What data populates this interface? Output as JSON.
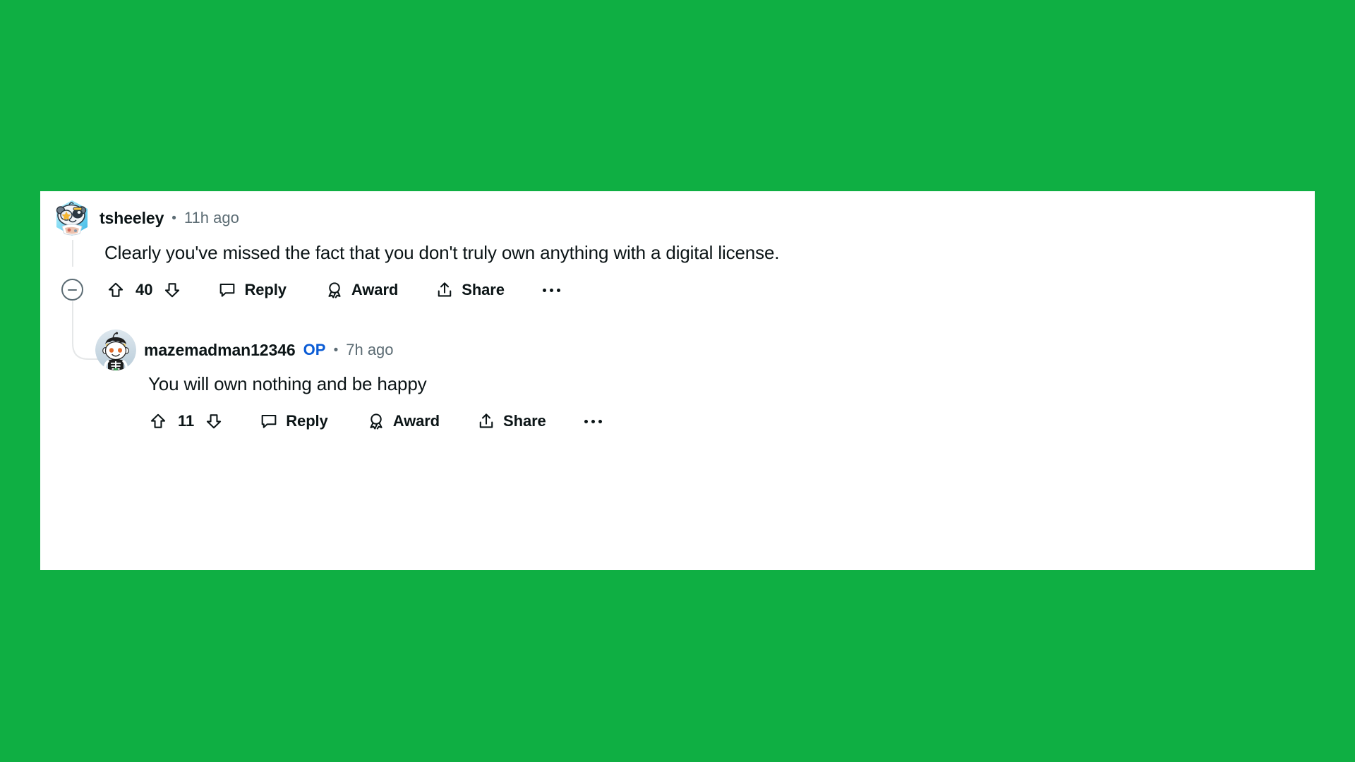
{
  "page": {
    "background_color": "#0FAF43",
    "card_background": "#FFFFFF",
    "platform": "reddit-comment-thread"
  },
  "comments": [
    {
      "id": "root",
      "author": "tsheeley",
      "is_op": false,
      "op_label": "",
      "separator": "•",
      "timestamp": "11h ago",
      "body": "Clearly you've missed the fact that you don't truly own anything with a digital license.",
      "avatar": {
        "name": "panda-gamer-avatar",
        "shape": "rounded-hex",
        "background_color": "#8FD8F0"
      },
      "actions": {
        "collapse_icon": "minus-circle-icon",
        "upvote_icon": "upvote-arrow-icon",
        "vote_count": "40",
        "downvote_icon": "downvote-arrow-icon",
        "reply_icon": "comment-bubble-icon",
        "reply_label": "Reply",
        "award_icon": "award-ribbon-icon",
        "award_label": "Award",
        "share_icon": "share-upload-icon",
        "share_label": "Share",
        "more_icon": "kebab-more-icon"
      }
    },
    {
      "id": "reply-1",
      "author": "mazemadman12346",
      "is_op": true,
      "op_label": "OP",
      "separator": "•",
      "timestamp": "7h ago",
      "body": "You will own nothing and be happy",
      "avatar": {
        "name": "snoo-skeleton-avatar",
        "shape": "circle",
        "background_color": "#C3D3DD"
      },
      "actions": {
        "upvote_icon": "upvote-arrow-icon",
        "vote_count": "11",
        "downvote_icon": "downvote-arrow-icon",
        "reply_icon": "comment-bubble-icon",
        "reply_label": "Reply",
        "award_icon": "award-ribbon-icon",
        "award_label": "Award",
        "share_icon": "share-upload-icon",
        "share_label": "Share",
        "more_icon": "kebab-more-icon"
      }
    }
  ],
  "colors": {
    "accent_green": "#0FAF43",
    "op_blue": "#0B5CD5",
    "text_primary": "#0B1416",
    "text_muted": "#5C6C74",
    "thread_line": "#E5E7E8"
  }
}
